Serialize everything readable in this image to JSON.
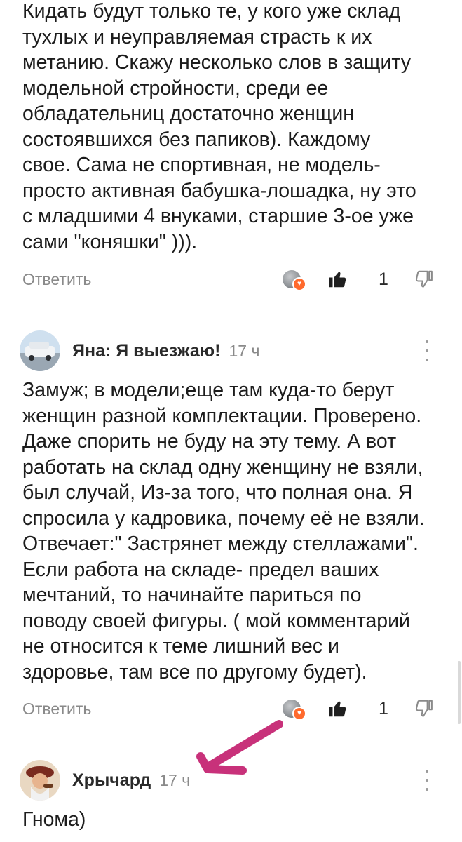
{
  "comments": [
    {
      "text": "Кидать будут только те, у кого уже склад\nтухлых и неуправляемая страсть к их\nметанию. Скажу несколько слов в защиту\nмодельной стройности, среди ее\nобладательниц достаточно женщин\nсостоявшихся без папиков). Каждому\nсвое. Сама не спортивная, не модель-\nпросто активная бабушка-лошадка, ну это\nс младшими 4 внуками, старшие 3-ое уже\nсами \"коняшки\" ))).",
      "reply_label": "Ответить",
      "like_count": "1",
      "reaction_icon": "heart-icon",
      "like_icon": "thumbs-up-icon",
      "dislike_icon": "thumbs-down-icon"
    },
    {
      "author": "Яна: Я выезжаю!",
      "time": "17 ч",
      "text": "Замуж; в модели;еще там куда-то берут\nженщин разной комплектации. Проверено.\nДаже спорить не буду на эту тему. А вот\nработать на склад одну женщину не взяли,\nбыл случай, Из-за того, что полная она. Я\nспросила у кадровика, почему её не взяли.\nОтвечает:\" Застрянет между стеллажами\".\nЕсли работа на складе- предел ваших\nмечтаний, то начинайте париться по\nповоду своей фигуры. ( мой комментарий\nне относится к теме лишний вес и\nздоровье, там все по другому будет).",
      "reply_label": "Ответить",
      "like_count": "1",
      "reaction_icon": "heart-icon",
      "like_icon": "thumbs-up-icon",
      "dislike_icon": "thumbs-down-icon",
      "more_icon": "more-vertical-icon"
    },
    {
      "author": "Хрычард",
      "time": "17 ч",
      "text": "Гнома)",
      "more_icon": "more-vertical-icon"
    }
  ],
  "annotation": {
    "arrow_color": "#c8317a"
  },
  "colors": {
    "text": "#1c1c1c",
    "muted": "#8a8a8a",
    "badge": "#ff6a2d"
  }
}
